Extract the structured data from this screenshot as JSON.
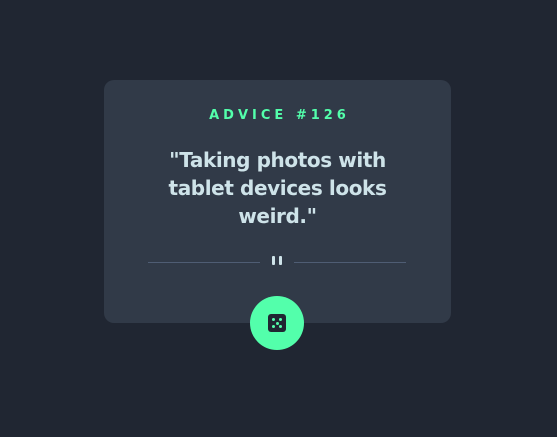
{
  "card": {
    "advice_label": "ADVICE #126",
    "quote": "\"Taking photos with tablet devices looks weird.\""
  },
  "icons": {
    "divider": "pause-icon",
    "button": "dice-icon"
  },
  "colors": {
    "background": "#202632",
    "card": "#313a48",
    "accent": "#53ffab",
    "text": "#cee3e9",
    "divider": "#4f5d74"
  }
}
